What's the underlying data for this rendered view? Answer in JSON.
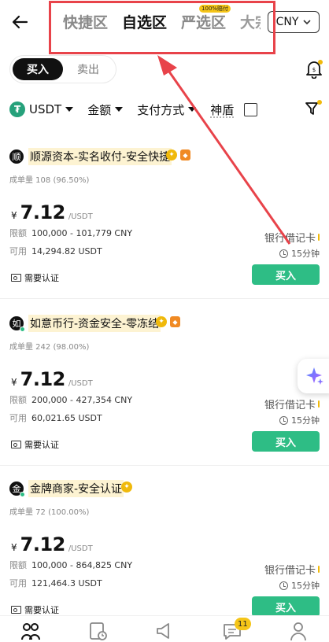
{
  "header": {
    "tabs": [
      {
        "label": "快捷区",
        "active": false
      },
      {
        "label": "自选区",
        "active": true
      },
      {
        "label": "严选区",
        "active": false,
        "badge": "100%赔付"
      },
      {
        "label": "大宗",
        "active": false
      }
    ],
    "currency": "CNY"
  },
  "trade_toggle": {
    "buy": "买入",
    "sell": "卖出",
    "selected": "buy"
  },
  "filters": {
    "coin": "USDT",
    "amount": "金额",
    "payment": "支付方式",
    "shield": "神盾",
    "shield_checked": false
  },
  "merchants": [
    {
      "avatar_char": "顺",
      "name": "顺源资本-实名收付-安全快捷",
      "badges": 2,
      "stats": "成单量 108 (96.50%)",
      "currency_symbol": "¥",
      "price": "7.12",
      "price_unit": "/USDT",
      "limit_label": "限额",
      "limit": "100,000 - 101,779 CNY",
      "avail_label": "可用",
      "available": "14,294.82 USDT",
      "kyc": "需要认证",
      "payment": "银行借记卡",
      "time": "15分钟",
      "buy_label": "买入"
    },
    {
      "avatar_char": "如",
      "name": "如意币行-资金安全-零冻结",
      "badges": 2,
      "stats": "成单量 242 (98.00%)",
      "currency_symbol": "¥",
      "price": "7.12",
      "price_unit": "/USDT",
      "limit_label": "限额",
      "limit": "200,000 - 427,354 CNY",
      "avail_label": "可用",
      "available": "60,021.65 USDT",
      "kyc": "需要认证",
      "payment": "银行借记卡",
      "time": "15分钟",
      "buy_label": "买入"
    },
    {
      "avatar_char": "金",
      "name": "金牌商家-安全认证",
      "badges": 1,
      "stats": "成单量 72 (100.00%)",
      "currency_symbol": "¥",
      "price": "7.12",
      "price_unit": "/USDT",
      "limit_label": "限额",
      "limit": "100,000 - 864,825 CNY",
      "avail_label": "可用",
      "available": "121,464.3 USDT",
      "kyc": "需要认证",
      "payment": "银行借记卡",
      "time": "15分钟",
      "buy_label": "买入"
    }
  ],
  "bottom_nav": {
    "messages_badge": "11"
  },
  "colors": {
    "buy_green": "#2ebd85",
    "annotation_red": "#e8434a",
    "accent_yellow": "#f0b90b"
  }
}
